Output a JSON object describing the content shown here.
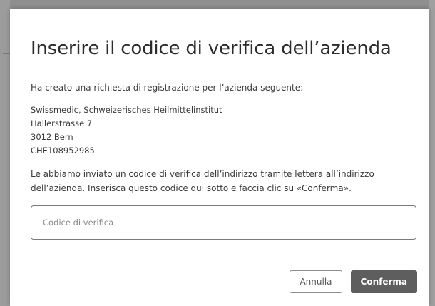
{
  "dialog": {
    "title": "Inserire il codice di verifica dell’azienda",
    "intro": "Ha creato una richiesta di registrazione per l’azienda seguente:",
    "address": {
      "line1": "Swissmedic, Schweizerisches Heilmittelinstitut",
      "line2": "Hallerstrasse 7",
      "line3": "3012 Bern",
      "line4": "CHE108952985"
    },
    "info": "Le abbiamo inviato un codice di verifica dell’indirizzo tramite lettera all’indirizzo dell’azienda. Inserisca questo codice qui sotto e faccia clic su «Conferma».",
    "code_input": {
      "placeholder": "Codice di verifica",
      "value": ""
    },
    "cancel_label": "Annulla",
    "confirm_label": "Conferma"
  },
  "colors": {
    "overlay": "#8f8f8f",
    "confirm_button": "#5e5e5e",
    "input_border": "#7a7a7a"
  }
}
